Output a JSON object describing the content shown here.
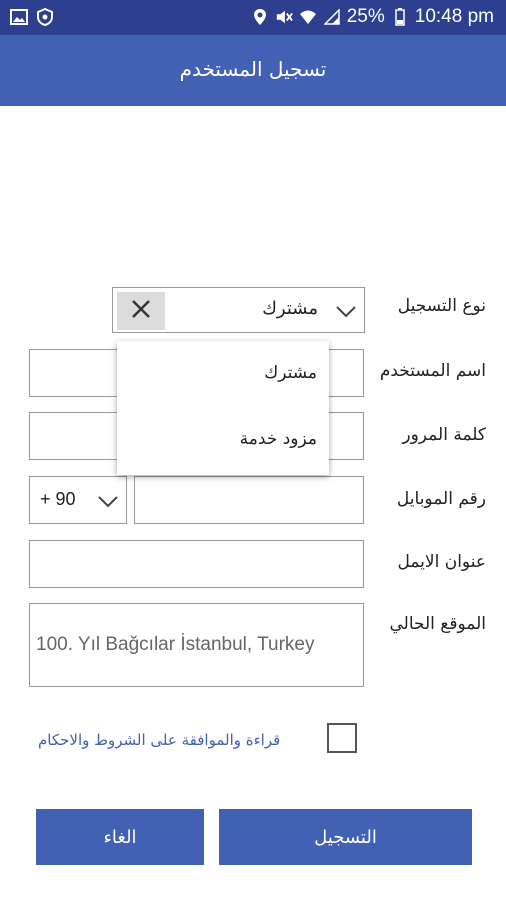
{
  "status_bar": {
    "battery": "25%",
    "time": "10:48 pm",
    "icons": [
      "image-icon",
      "shield-icon",
      "location-icon",
      "mute-icon",
      "wifi-icon",
      "signal-icon",
      "battery-icon"
    ]
  },
  "app_bar": {
    "title": "تسجيل المستخدم"
  },
  "form": {
    "registration_type_label": "نوع التسجيل",
    "registration_type_value": "مشترك",
    "dropdown_options": [
      "مشترك",
      "مزود خدمة"
    ],
    "username_label": "اسم المستخدم",
    "username_value": "",
    "password_label": "كلمة المرور",
    "password_value": "",
    "mobile_label": "رقم الموبايل",
    "country_code": "+ 90",
    "mobile_value": "",
    "email_label": "عنوان الايمل",
    "email_value": "",
    "location_label": "الموقع الحالي",
    "location_value": "100. Yıl  Bağcılar İstanbul, Turkey",
    "terms_text": "قراءة والموافقة على الشروط والاحكام",
    "terms_checked": false
  },
  "buttons": {
    "register": "التسجيل",
    "cancel": "الغاء"
  },
  "colors": {
    "status_bar": "#2e3f8f",
    "primary": "#4361b4",
    "field_border": "#9a9a9a"
  }
}
